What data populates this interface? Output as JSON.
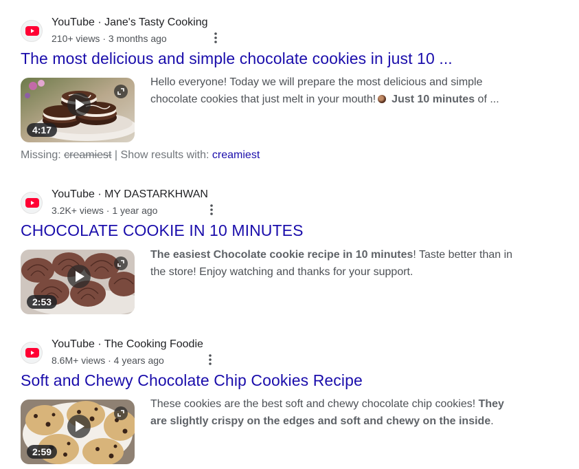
{
  "results": [
    {
      "source": "YouTube · Jane's Tasty Cooking",
      "meta": "210+ views · 3 months ago",
      "title": "The most delicious and simple chocolate cookies in just 10 ...",
      "duration": "4:17",
      "snippet": {
        "part1": "Hello everyone! Today we will prepare the most delicious and simple chocolate cookies that just melt in your mouth!",
        "emoji_icon": "cookie-emoji-icon",
        "bold1": "Just 10 minutes",
        "part2": " of ..."
      },
      "missing": {
        "label": "Missing: ",
        "struck_term": "creamiest",
        "separator": " | Show results with: ",
        "link": "creamiest"
      },
      "thumbnail_subject": "stacked chocolate sandwich cookies with white drizzle"
    },
    {
      "source": "YouTube · MY DASTARKHWAN",
      "meta": "3.2K+ views · 1 year ago",
      "title": "CHOCOLATE COOKIE IN 10 MINUTES",
      "duration": "2:53",
      "snippet": {
        "bold1": "The easiest Chocolate cookie recipe in 10 minutes",
        "part1": "! Taste better than in the store! Enjoy watching and thanks for your support."
      },
      "thumbnail_subject": "shell-shaped chocolate cookies"
    },
    {
      "source": "YouTube · The Cooking Foodie",
      "meta": "8.6M+ views · 4 years ago",
      "title": "Soft and Chewy Chocolate Chip Cookies Recipe",
      "duration": "2:59",
      "snippet": {
        "part1": "These cookies are the best soft and chewy chocolate chip cookies! ",
        "bold1": "They are slightly crispy on the edges and soft and chewy on the inside",
        "part2": "."
      },
      "thumbnail_subject": "chocolate chip cookies on a plate"
    }
  ],
  "icons": {
    "source_logo": "youtube-logo-icon",
    "menu": "more-vert-icon",
    "play": "play-icon",
    "expand": "expand-icon"
  },
  "colors": {
    "title_link": "#1a0dab",
    "youtube_red": "#ff0033",
    "snippet_text": "#4d5156",
    "meta_text": "#4d5156"
  }
}
